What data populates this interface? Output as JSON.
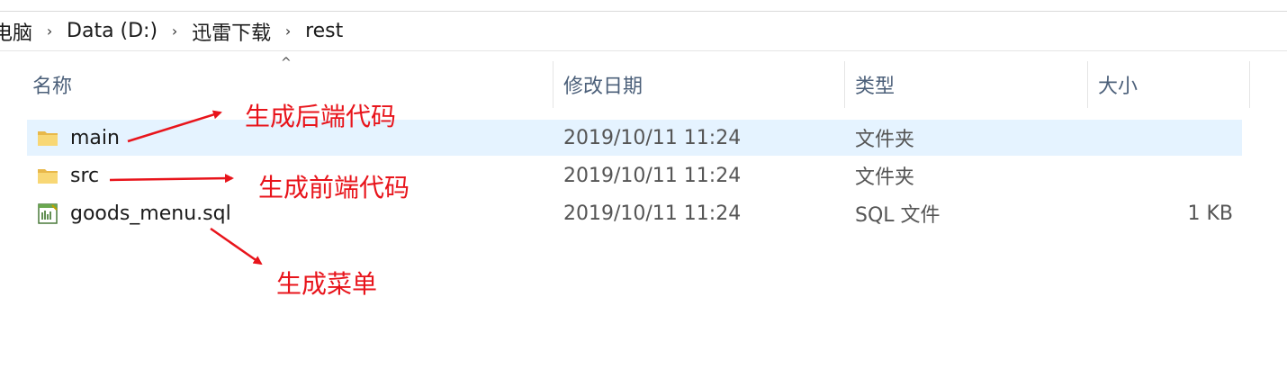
{
  "breadcrumb": [
    "电脑",
    "Data (D:)",
    "迅雷下载",
    "rest"
  ],
  "breadcrumb_separator": "›",
  "sort_indicator": "^",
  "columns": {
    "name": "名称",
    "date": "修改日期",
    "type": "类型",
    "size": "大小"
  },
  "files": [
    {
      "name": "main",
      "date": "2019/10/11 11:24",
      "type": "文件夹",
      "size": "",
      "icon": "folder-icon",
      "selected": true
    },
    {
      "name": "src",
      "date": "2019/10/11 11:24",
      "type": "文件夹",
      "size": "",
      "icon": "folder-icon",
      "selected": false
    },
    {
      "name": "goods_menu.sql",
      "date": "2019/10/11 11:24",
      "type": "SQL 文件",
      "size": "1 KB",
      "icon": "sql-file-icon",
      "selected": false
    }
  ],
  "annotations": {
    "backend": "生成后端代码",
    "frontend": "生成前端代码",
    "menu": "生成菜单"
  },
  "colors": {
    "annotation": "#e8141b",
    "header_text": "#4c607a",
    "selection": "#e5f3ff",
    "folder": "#f8d775"
  }
}
